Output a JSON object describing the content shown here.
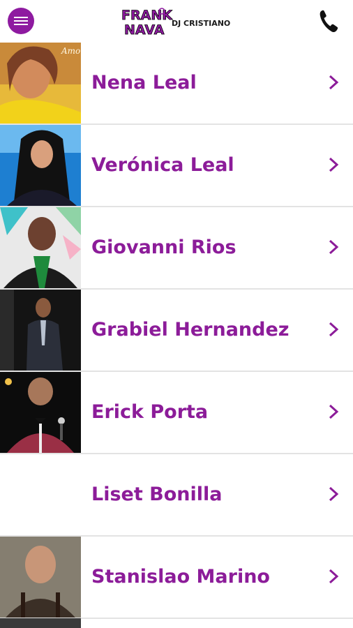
{
  "header": {
    "menu_icon": "hamburger-menu-icon",
    "logo_line1": "FRANK",
    "logo_line2": "NAVA",
    "logo_subtitle": "DJ CRISTIANO",
    "phone_icon": "phone-icon",
    "accent_color": "#8e1aa0"
  },
  "artists": [
    {
      "name": "Nena Leal"
    },
    {
      "name": "Verónica Leal"
    },
    {
      "name": "Giovanni Rios"
    },
    {
      "name": "Grabiel Hernandez"
    },
    {
      "name": "Erick Porta"
    },
    {
      "name": "Liset Bonilla"
    },
    {
      "name": "Stanislao Marino"
    }
  ],
  "list_chevron_icon": "chevron-right-icon",
  "name_color": "#8c1c99"
}
